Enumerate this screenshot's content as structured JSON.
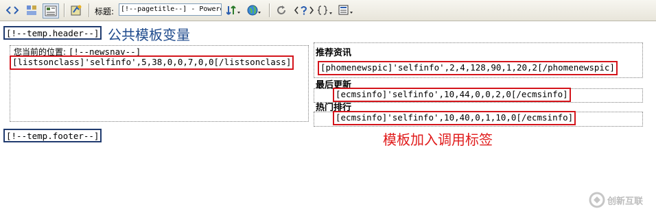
{
  "toolbar": {
    "title_label": "标题:",
    "title_value": "[!--pagetitle--] - Powere"
  },
  "template": {
    "header_tag": "[!--temp.header--]",
    "header_note": "公共模板变量",
    "footer_tag": "[!--temp.footer--]",
    "location_label": "您当前的位置:",
    "location_value": "[!--newsnav--]",
    "listsonclass": "[listsonclass]'selfinfo',5,38,0,0,7,0,0[/listsonclass]"
  },
  "sidebar": {
    "recommend_heading": "推荐资讯",
    "recommend_tag": "[phomenewspic]'selfinfo',2,4,128,90,1,20,2[/phomenewspic]",
    "latest_heading": "最后更新",
    "latest_tag": "[ecmsinfo]'selfinfo',10,44,0,0,2,0[/ecmsinfo]",
    "hot_heading": "热门排行",
    "hot_tag": "[ecmsinfo]'selfinfo',10,40,0,1,10,0[/ecmsinfo]"
  },
  "annotation": {
    "insert_tags": "模板加入调用标签"
  },
  "watermark": {
    "brand": "创新互联"
  }
}
